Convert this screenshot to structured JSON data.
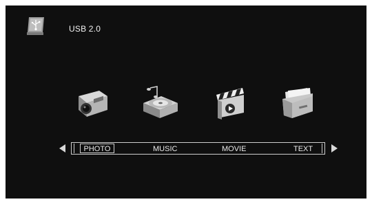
{
  "header": {
    "device_title": "USB 2.0",
    "device_icon": "usb-drive-icon"
  },
  "menu": {
    "selected_index": 0,
    "items": [
      {
        "label": "PHOTO",
        "icon": "camera-icon"
      },
      {
        "label": "MUSIC",
        "icon": "record-player-icon"
      },
      {
        "label": "MOVIE",
        "icon": "clapperboard-icon"
      },
      {
        "label": "TEXT",
        "icon": "file-folder-icon"
      }
    ]
  },
  "colors": {
    "screen_background": "#0f0f0f",
    "text": "#e8e8e8",
    "outline": "#cfcfcf"
  }
}
